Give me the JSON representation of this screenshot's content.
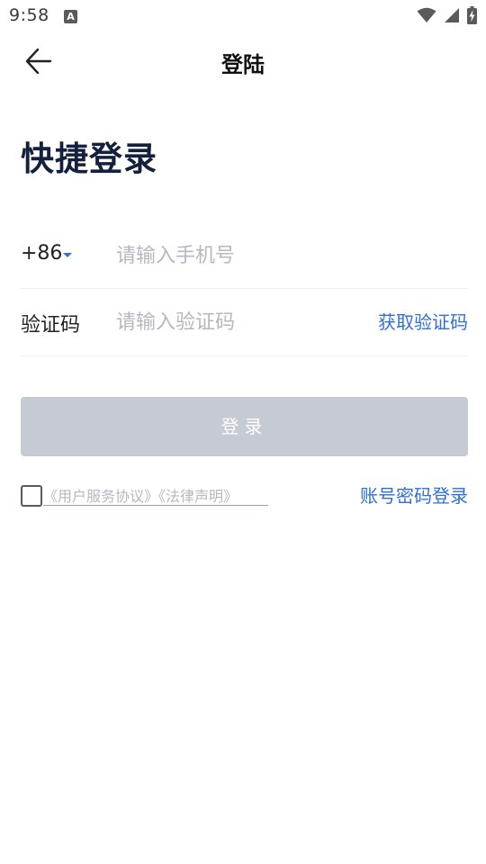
{
  "status_bar": {
    "time": "9:58",
    "app_badge": "A",
    "icons": [
      "wifi-icon",
      "cellular-signal-icon",
      "battery-charging-icon"
    ]
  },
  "nav": {
    "title": "登陆",
    "back_icon": "arrow-left-icon"
  },
  "page": {
    "title": "快捷登录"
  },
  "phone": {
    "country_code": "+86",
    "placeholder": "请输入手机号",
    "value": ""
  },
  "code": {
    "label": "验证码",
    "placeholder": "请输入验证码",
    "value": "",
    "get_code_label": "获取验证码"
  },
  "login": {
    "label": "登录"
  },
  "agreement": {
    "checked": false,
    "user_agreement": "《用户服务协议》",
    "legal_statement": "《法律声明》"
  },
  "alt_login": {
    "label": "账号密码登录"
  },
  "colors": {
    "accent": "#2e6fd8",
    "title": "#14213d",
    "disabled_button": "#c5cad3",
    "placeholder": "#b3b8c2",
    "divider": "#eceef1"
  }
}
